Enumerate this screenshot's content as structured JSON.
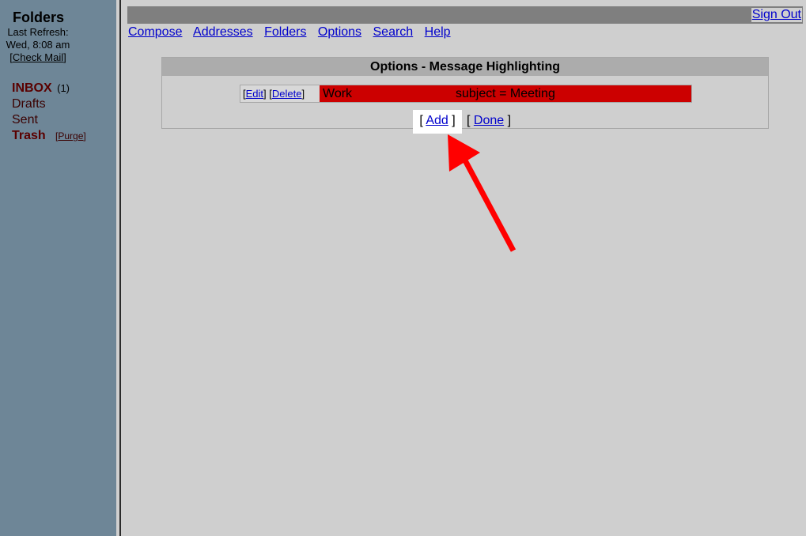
{
  "sidebar": {
    "title": "Folders",
    "last_refresh_label": "Last Refresh:",
    "refresh_time": "Wed, 8:08 am",
    "check_mail": "Check Mail",
    "folders": {
      "inbox": "INBOX",
      "inbox_count": "(1)",
      "drafts": "Drafts",
      "sent": "Sent",
      "trash": "Trash",
      "purge": "Purge"
    }
  },
  "header": {
    "sign_out": "Sign Out"
  },
  "nav": [
    "Compose",
    "Addresses",
    "Folders",
    "Options",
    "Search",
    "Help"
  ],
  "options": {
    "title": "Options - Message Highlighting",
    "rule": {
      "edit": "Edit",
      "delete": "Delete",
      "name": "Work",
      "condition": "subject = Meeting",
      "color": "#cc0000"
    },
    "add": "Add",
    "done": "Done"
  },
  "colors": {
    "sidebar_bg": "#6e8697",
    "page_bg": "#cfcfcf",
    "link": "#0000cc",
    "arrow": "#ff0000"
  }
}
